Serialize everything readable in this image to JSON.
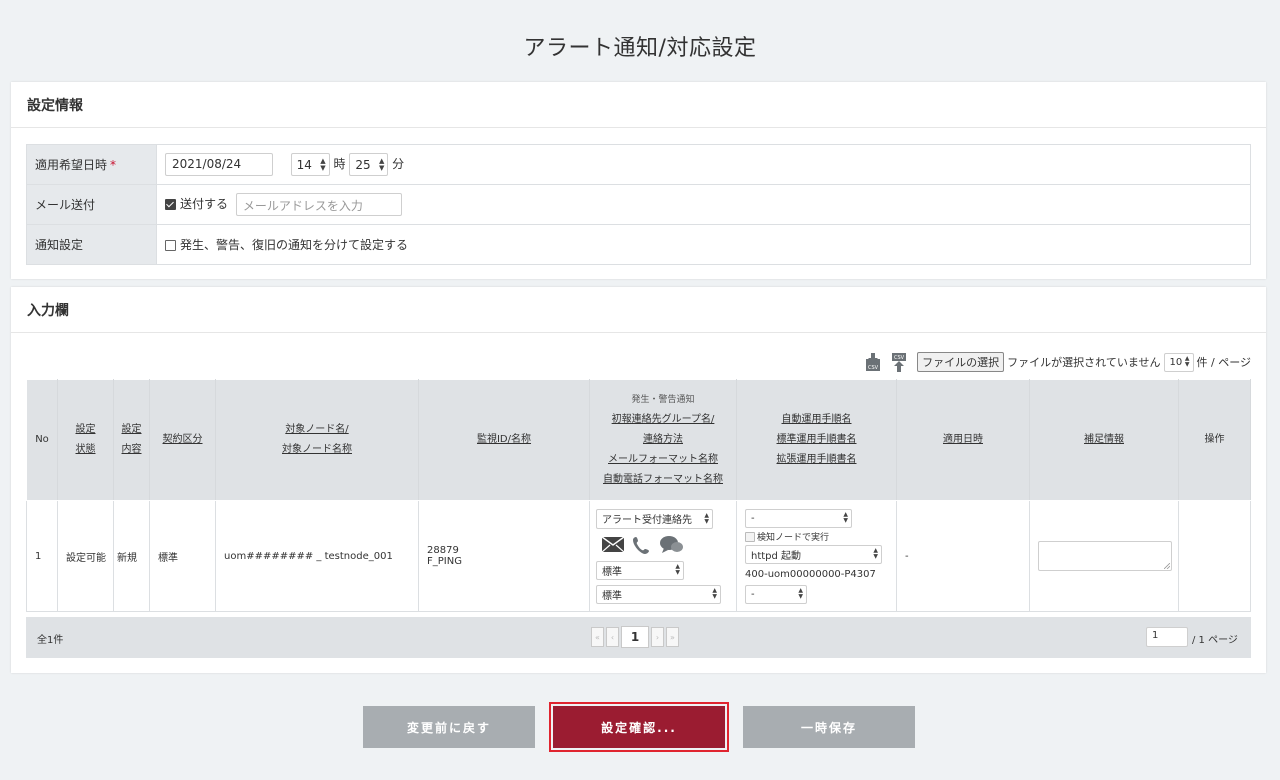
{
  "page_title": "アラート通知/対応設定",
  "settings": {
    "header": "設定情報",
    "date_label": "適用希望日時",
    "required_mark": "*",
    "date_value": "2021/08/24",
    "hour_value": "14",
    "hour_unit": "時",
    "minute_value": "25",
    "minute_unit": "分",
    "mail_label": "メール送付",
    "mail_checkbox_label": "送付する",
    "mail_placeholder": "メールアドレスを入力",
    "notify_label": "通知設定",
    "notify_checkbox_label": "発生、警告、復旧の通知を分けて設定する"
  },
  "input_section": {
    "header": "入力欄",
    "file_button": "ファイルの選択",
    "file_status": "ファイルが選択されていません",
    "page_size": "10",
    "page_size_unit": "件 / ページ",
    "csv_label": "CSV"
  },
  "table": {
    "headers": {
      "no": "No",
      "status_1": "設定",
      "status_2": "状態",
      "content_1": "設定",
      "content_2": "内容",
      "contract": "契約区分",
      "node_1": "対象ノード名/",
      "node_2": "対象ノード名称",
      "monitor": "監視ID/名称",
      "notify_0": "発生・警告通知",
      "notify_1": "初報連絡先グループ名/",
      "notify_2": "連絡方法",
      "notify_3": "メールフォーマット名称",
      "notify_4": "自動電話フォーマット名称",
      "auto_1": "自動運用手順名",
      "auto_2": "標準運用手順書名",
      "auto_3": "拡張運用手順書名",
      "apply_date": "適用日時",
      "extra": "補足情報",
      "ops": "操作"
    },
    "rows": [
      {
        "no": "1",
        "status": "設定可能",
        "content": "新規",
        "contract": "標準",
        "node": "uom######## _ testnode_001",
        "monitor_id": "28879",
        "monitor_name": "F_PING",
        "contact_group": "アラート受付連絡先",
        "mail_format": "標準",
        "phone_format": "標準",
        "auto_proc": "-",
        "detect_node_label": "検知ノードで実行",
        "std_proc": "httpd 起動",
        "proc_id": "400-uom00000000-P4307",
        "ext_proc": "-",
        "apply_date": "-"
      }
    ]
  },
  "footer": {
    "total": "全1件",
    "current_page": "1",
    "page_input": "1",
    "page_total": "/ 1 ページ"
  },
  "buttons": {
    "revert": "変更前に戻す",
    "confirm": "設定確認...",
    "save": "一時保存"
  },
  "colors": {
    "primary": "#9b1c31",
    "grey_button": "#a8adb1",
    "required": "#c8102e"
  }
}
